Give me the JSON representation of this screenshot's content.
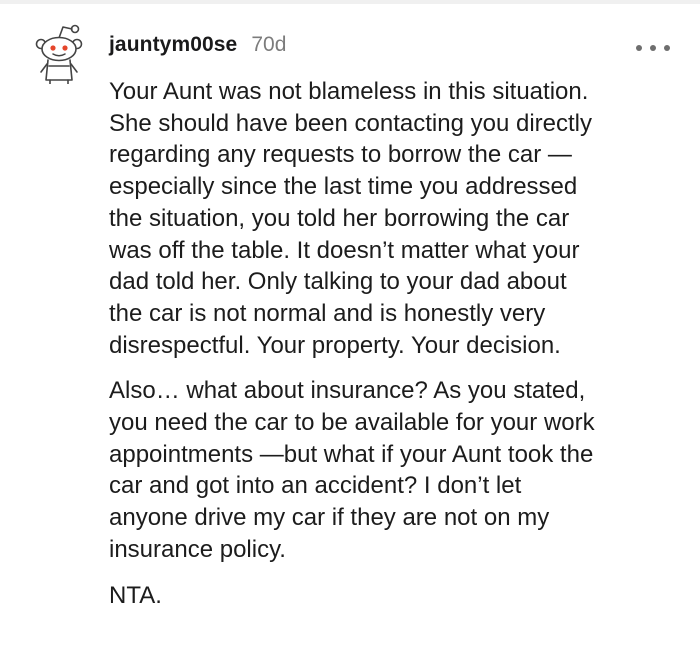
{
  "comment": {
    "username": "jauntym00se",
    "age": "70d",
    "avatar_icon": "reddit-snoo-avatar-icon",
    "more_icon": "more-options-icon",
    "paragraphs": [
      "Your Aunt was not blameless in this situation.\nShe should have been contacting you directly\nregarding any requests to borrow the car —\nespecially since the last time you addressed\nthe situation, you told her borrowing the car\nwas off the table. It doesn’t matter what your\ndad told her. Only talking to your dad about\nthe car is not normal and is honestly very\ndisrespectful. Your property. Your decision.",
      "Also… what about insurance? As you stated,\nyou need the car to be available for your work\nappointments —but what if your Aunt took the\ncar and got into an accident? I don’t let\nanyone drive my car if they are not on my\ninsurance policy.",
      "NTA."
    ]
  }
}
